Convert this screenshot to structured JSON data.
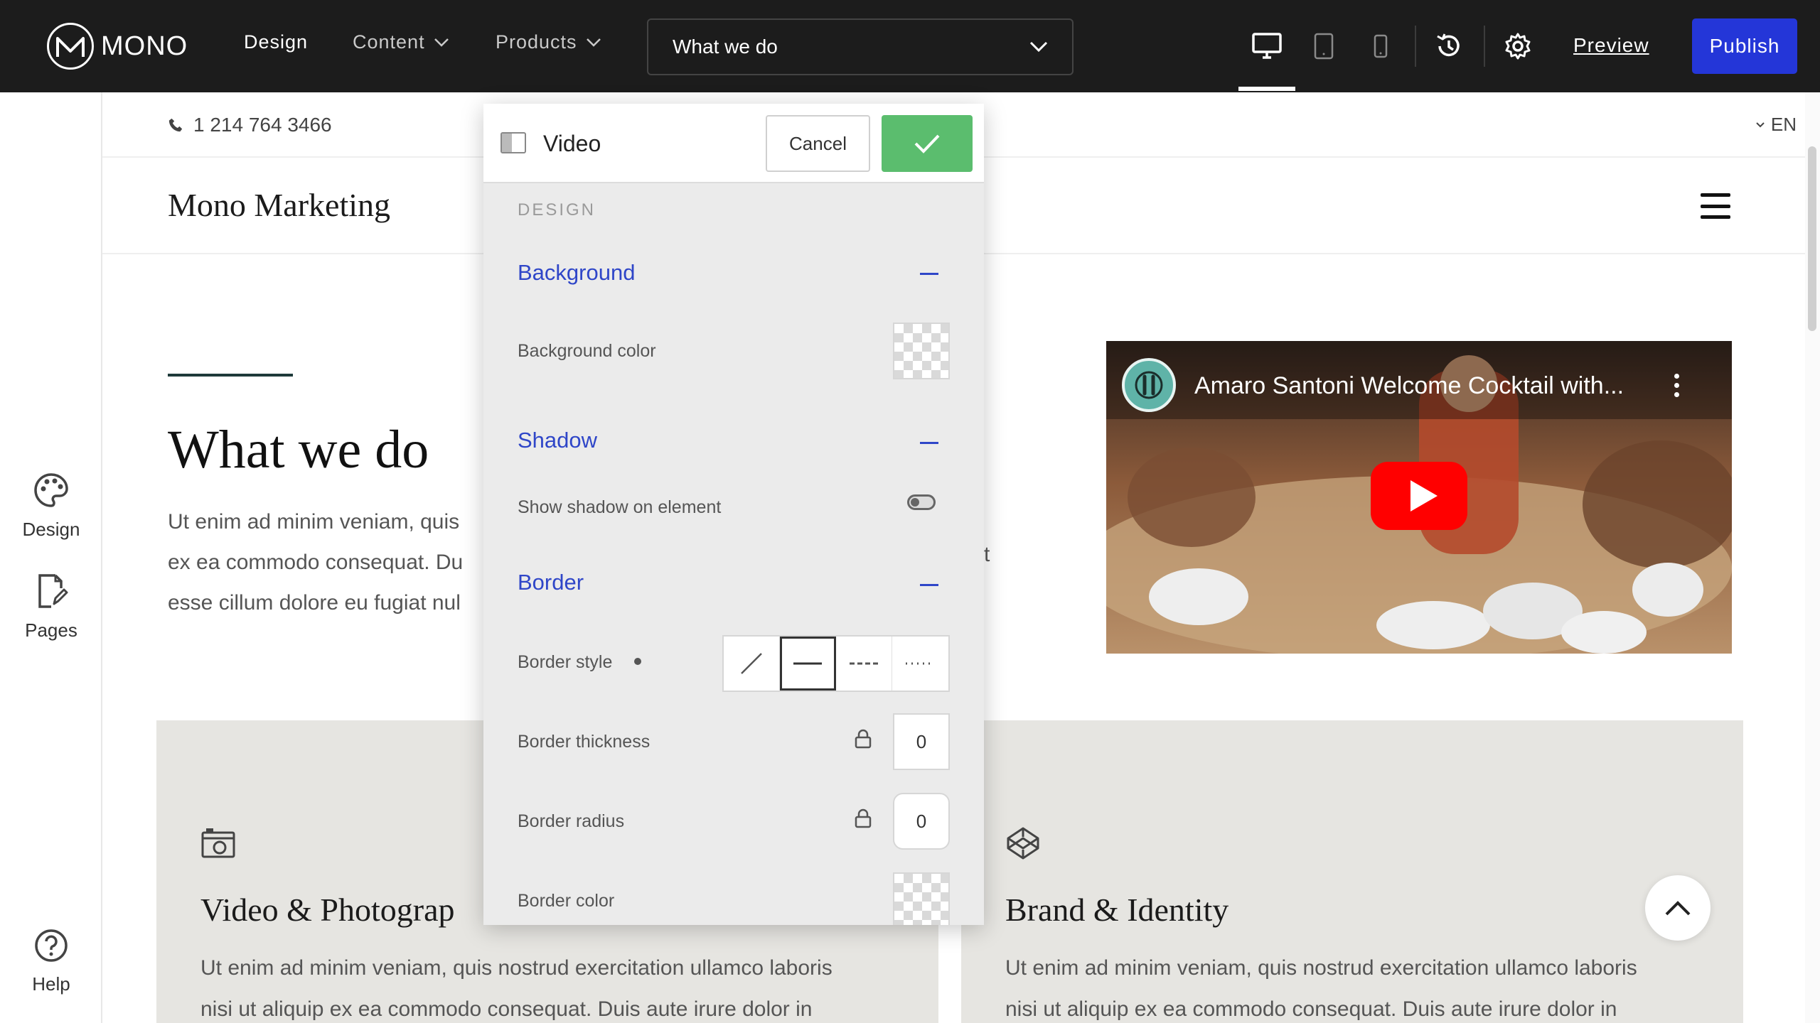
{
  "topbar": {
    "logo_text": "MONO",
    "nav": [
      {
        "label": "Design"
      },
      {
        "label": "Content"
      },
      {
        "label": "Products"
      }
    ],
    "page_selector": "What we do",
    "preview_label": "Preview",
    "publish_label": "Publish"
  },
  "sidebar": {
    "design_label": "Design",
    "pages_label": "Pages",
    "help_label": "Help"
  },
  "site": {
    "phone": "1 214 764 3466",
    "lang": "EN",
    "brand": "Mono Marketing",
    "hero": {
      "title": "What we do",
      "line1": "Ut enim ad minim veniam, quis",
      "line2": "ex ea commodo consequat. Du",
      "line3": "esse cillum dolore eu fugiat nul",
      "overflow_char": "t"
    },
    "video": {
      "title": "Amaro Santoni Welcome Cocktail with..."
    },
    "cards": [
      {
        "title": "Video & Photograp",
        "body1": "Ut enim ad minim veniam, quis nostrud exercitation ullamco laboris",
        "body2": "nisi ut aliquip ex ea commodo consequat. Duis aute irure dolor in"
      },
      {
        "title": "Brand & Identity",
        "body1": "Ut enim ad minim veniam, quis nostrud exercitation ullamco laboris",
        "body2": "nisi ut aliquip ex ea commodo consequat. Duis aute irure dolor in"
      }
    ]
  },
  "panel": {
    "title": "Video",
    "cancel_label": "Cancel",
    "section": "DESIGN",
    "background": {
      "title": "Background",
      "color_label": "Background color"
    },
    "shadow": {
      "title": "Shadow",
      "toggle_label": "Show shadow on element",
      "enabled": false
    },
    "border": {
      "title": "Border",
      "style_label": "Border style",
      "thickness_label": "Border thickness",
      "thickness_value": "0",
      "radius_label": "Border radius",
      "radius_value": "0",
      "color_label": "Border color"
    }
  },
  "colors": {
    "accent": "#2436d8",
    "confirm": "#5bbd6e",
    "group_title": "#2f46c8"
  }
}
